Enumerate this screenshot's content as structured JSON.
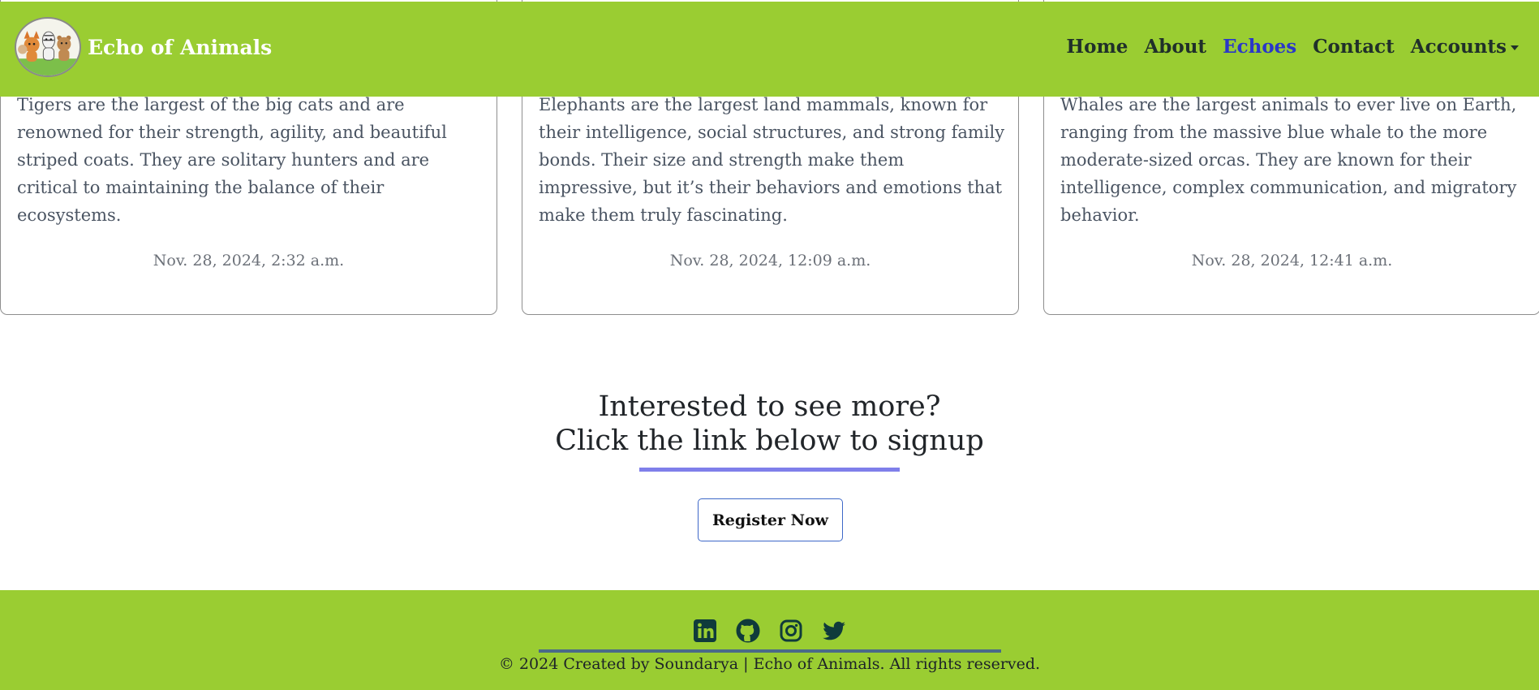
{
  "brand": {
    "name": "Echo of Animals",
    "logo_icon": "animals-logo-icon"
  },
  "nav": {
    "items": [
      {
        "label": "Home",
        "active": false
      },
      {
        "label": "About",
        "active": false
      },
      {
        "label": "Echoes",
        "active": true
      },
      {
        "label": "Contact",
        "active": false
      },
      {
        "label": "Accounts",
        "active": false,
        "dropdown": true
      }
    ],
    "active_color": "#2a37c9"
  },
  "cards": [
    {
      "text": "Tigers are the largest of the big cats and are renowned for their strength, agility, and beautiful striped coats. They are solitary hunters and are critical to maintaining the balance of their ecosystems.",
      "date": "Nov. 28, 2024, 2:32 a.m."
    },
    {
      "text": "Elephants are the largest land mammals, known for their intelligence, social structures, and strong family bonds. Their size and strength make them impressive, but it’s their behaviors and emotions that make them truly fascinating.",
      "date": "Nov. 28, 2024, 12:09 a.m."
    },
    {
      "text": "Whales are the largest animals to ever live on Earth, ranging from the massive blue whale to the more moderate-sized orcas. They are known for their intelligence, complex communication, and migratory behavior.",
      "date": "Nov. 28, 2024, 12:41 a.m."
    }
  ],
  "signup": {
    "line1": "Interested to see more?",
    "line2": "Click the link below to signup",
    "button_label": "Register Now"
  },
  "footer": {
    "socials": [
      "linkedin-icon",
      "github-icon",
      "instagram-icon",
      "twitter-icon"
    ],
    "copyright": "© 2024 Created by Soundarya | Echo of Animals. All rights reserved."
  },
  "colors": {
    "brand_green": "#9acd32",
    "accent_bar": "#7f7fea",
    "icon_dark": "#0f3b3b"
  }
}
